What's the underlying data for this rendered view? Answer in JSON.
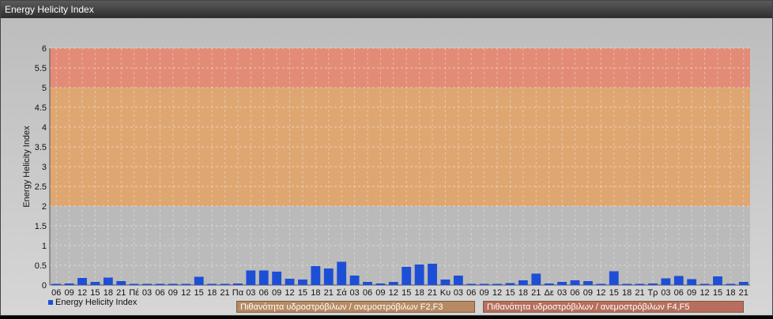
{
  "window_title": "Energy Helicity Index",
  "colors": {
    "bar": "#1d4fd6",
    "zone_low": "#b9b9b9",
    "zone_mid": "#e0a46a",
    "zone_high": "#e58872"
  },
  "legend": {
    "series_label": "Energy Helicity Index",
    "zone_f2f3": "Πιθανότητα υδροστρόβιλων / ανεμοστρόβιλων F2,F3",
    "zone_f4f5": "Πιθανότητα υδροστρόβιλων / ανεμοστρόβιλων F4,F5"
  },
  "chart_data": {
    "type": "bar",
    "title": "",
    "ylabel": "Energy Helicity Index",
    "xlabel": "",
    "ylim": [
      0,
      6
    ],
    "yticks": [
      0,
      0.5,
      1,
      1.5,
      2,
      2.5,
      3,
      3.5,
      4,
      4.5,
      5,
      5.5,
      6
    ],
    "grid": true,
    "zones": [
      {
        "from": 0,
        "to": 2,
        "color": "#b9b9b9"
      },
      {
        "from": 2,
        "to": 5,
        "color": "#e0a46a"
      },
      {
        "from": 5,
        "to": 6,
        "color": "#e58872"
      }
    ],
    "categories": [
      "06",
      "09",
      "12",
      "15",
      "18",
      "21",
      "Πέ",
      "03",
      "06",
      "09",
      "12",
      "15",
      "18",
      "21",
      "Πα",
      "03",
      "06",
      "09",
      "12",
      "15",
      "18",
      "21",
      "Σά",
      "03",
      "06",
      "09",
      "12",
      "15",
      "18",
      "21",
      "Κυ",
      "03",
      "06",
      "09",
      "12",
      "15",
      "18",
      "21",
      "Δε",
      "03",
      "06",
      "09",
      "12",
      "15",
      "18",
      "21",
      "Τρ",
      "03",
      "06",
      "09",
      "12",
      "15",
      "18",
      "21"
    ],
    "values": [
      0.03,
      0.04,
      0.18,
      0.08,
      0.19,
      0.1,
      0.01,
      0.03,
      0.03,
      0.02,
      0.02,
      0.21,
      0.01,
      0.02,
      0.04,
      0.37,
      0.37,
      0.34,
      0.16,
      0.14,
      0.48,
      0.42,
      0.59,
      0.24,
      0.08,
      0.04,
      0.08,
      0.46,
      0.52,
      0.54,
      0.14,
      0.24,
      0.02,
      0.03,
      0.02,
      0.05,
      0.12,
      0.29,
      0.04,
      0.08,
      0.12,
      0.1,
      0.02,
      0.35,
      0.02,
      0.02,
      0.04,
      0.17,
      0.23,
      0.15,
      0.02,
      0.22,
      0.02,
      0.08
    ],
    "legend": [
      "Energy Helicity Index"
    ],
    "legend_position": "bottom-left"
  }
}
